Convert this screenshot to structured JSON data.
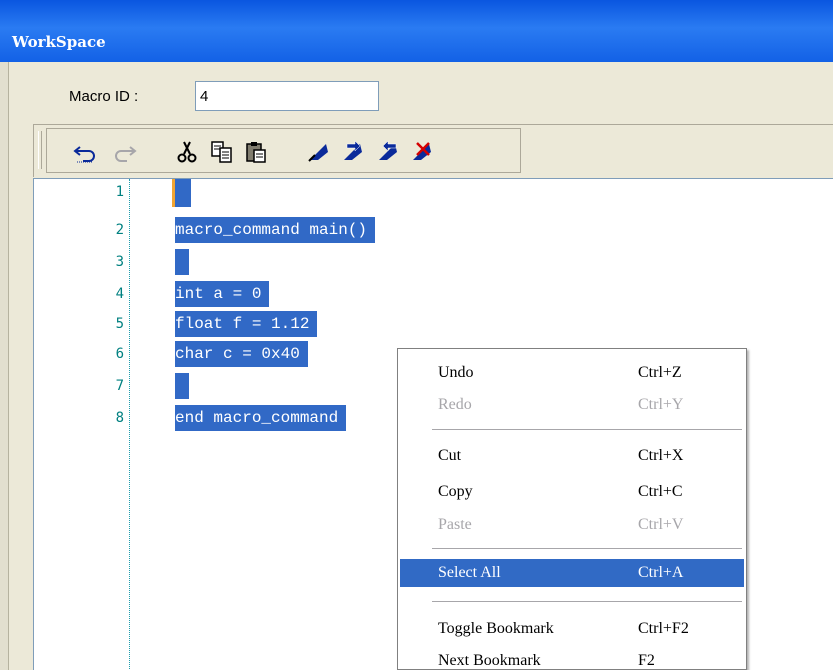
{
  "window": {
    "title": "WorkSpace"
  },
  "macro": {
    "label": "Macro ID :",
    "value": "4"
  },
  "toolbar": {
    "buttons": [
      {
        "name": "undo-icon",
        "enabled": true
      },
      {
        "name": "redo-icon",
        "enabled": false
      },
      {
        "name": "cut-icon",
        "enabled": true
      },
      {
        "name": "copy-icon",
        "enabled": true
      },
      {
        "name": "paste-icon",
        "enabled": true
      },
      {
        "name": "toggle-bookmark-icon",
        "enabled": true
      },
      {
        "name": "next-bookmark-icon",
        "enabled": true
      },
      {
        "name": "previous-bookmark-icon",
        "enabled": true
      },
      {
        "name": "clear-bookmarks-icon",
        "enabled": true
      }
    ]
  },
  "editor": {
    "line_numbers": [
      "1",
      "2",
      "3",
      "4",
      "5",
      "6",
      "7",
      "8"
    ],
    "lines": [
      "",
      "macro_command main()",
      "",
      "int a = 0",
      "float f = 1.12",
      "char c = 0x40",
      "",
      "end macro_command"
    ],
    "selection_color": "#3169c6"
  },
  "context_menu": {
    "items": [
      {
        "label": "Undo",
        "shortcut": "Ctrl+Z",
        "enabled": true
      },
      {
        "label": "Redo",
        "shortcut": "Ctrl+Y",
        "enabled": false
      },
      {
        "label": "Cut",
        "shortcut": "Ctrl+X",
        "enabled": true
      },
      {
        "label": "Copy",
        "shortcut": "Ctrl+C",
        "enabled": true
      },
      {
        "label": "Paste",
        "shortcut": "Ctrl+V",
        "enabled": false
      },
      {
        "label": "Select All",
        "shortcut": "Ctrl+A",
        "enabled": true,
        "highlighted": true
      },
      {
        "label": "Toggle Bookmark",
        "shortcut": "Ctrl+F2",
        "enabled": true
      },
      {
        "label": "Next Bookmark",
        "shortcut": "F2",
        "enabled": true
      }
    ]
  },
  "colors": {
    "title_bar": "#1361e6",
    "highlight": "#316ac5",
    "line_number": "#008080",
    "caret": "#f2a533"
  }
}
